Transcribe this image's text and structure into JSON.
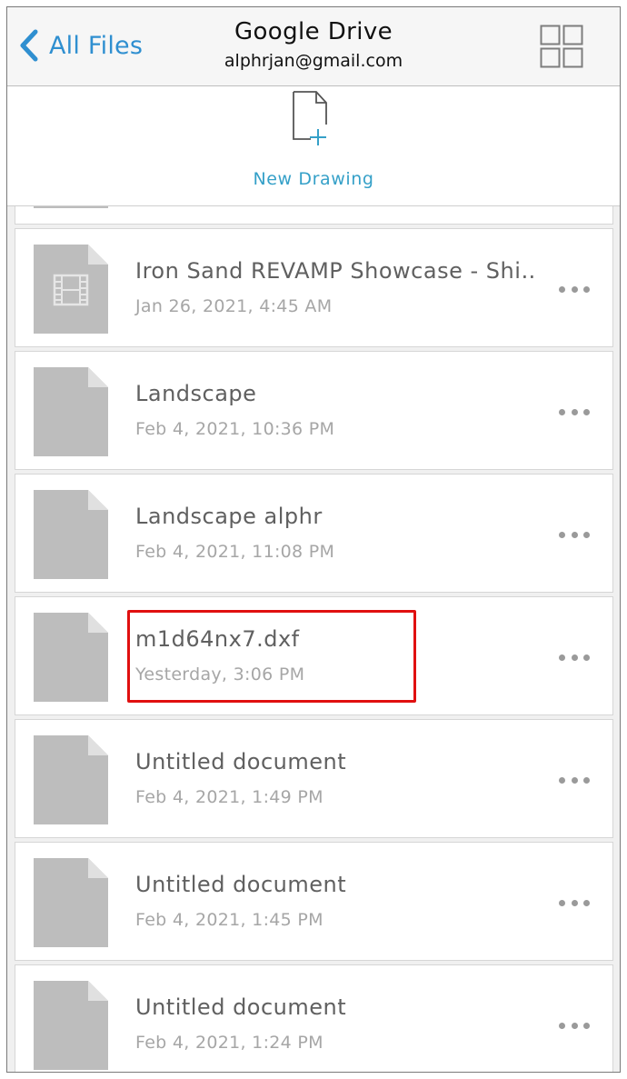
{
  "header": {
    "back_label": "All Files",
    "title": "Google Drive",
    "account": "alphrjan@gmail.com",
    "back_icon": "chevron-left-icon",
    "view_icon": "grid-view-icon",
    "accent_color": "#2f8fd0"
  },
  "new_drawing": {
    "label": "New Drawing",
    "icon": "new-file-icon",
    "accent_color": "#35a0c8"
  },
  "files": [
    {
      "name": "Iron Sand REVAMP Showcase - Shi…",
      "date": "Jan 26, 2021, 4:45 AM",
      "icon": "video-file-icon"
    },
    {
      "name": "Landscape",
      "date": "Feb 4, 2021, 10:36 PM",
      "icon": "file-icon"
    },
    {
      "name": "Landscape alphr",
      "date": "Feb 4, 2021, 11:08 PM",
      "icon": "file-icon"
    },
    {
      "name": "m1d64nx7.dxf",
      "date": "Yesterday, 3:06 PM",
      "icon": "file-icon",
      "highlighted": true
    },
    {
      "name": "Untitled document",
      "date": "Feb 4, 2021, 1:49 PM",
      "icon": "file-icon"
    },
    {
      "name": "Untitled document",
      "date": "Feb 4, 2021, 1:45 PM",
      "icon": "file-icon"
    },
    {
      "name": "Untitled document",
      "date": "Feb 4, 2021, 1:24 PM",
      "icon": "file-icon"
    }
  ],
  "highlight_color": "#e01010",
  "more_icon": "more-horizontal-icon"
}
